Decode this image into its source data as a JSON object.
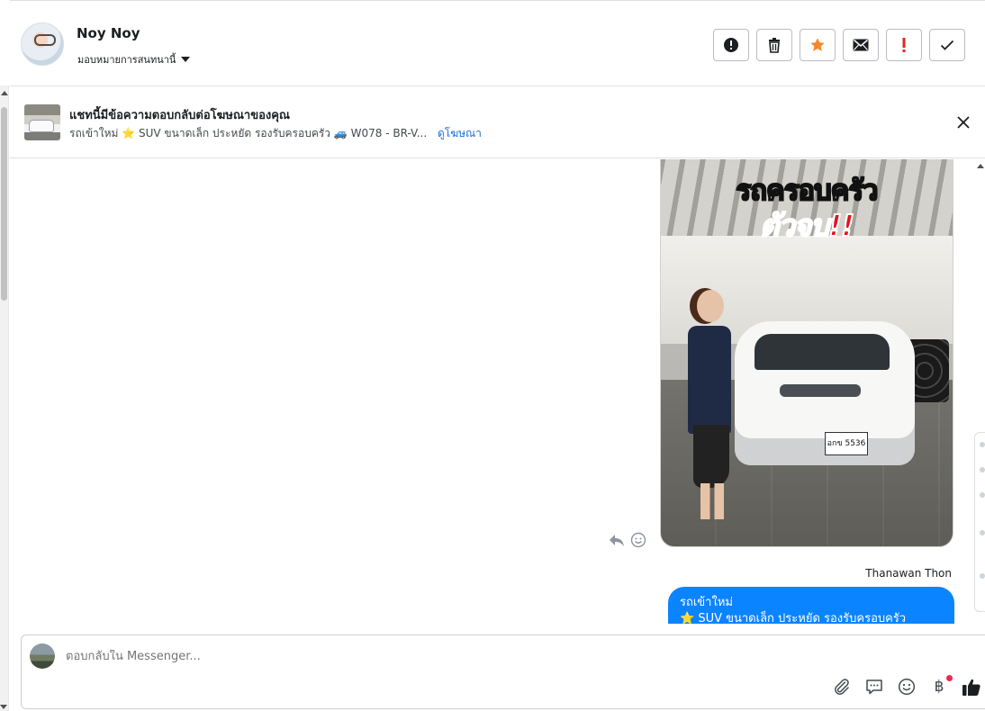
{
  "header": {
    "user_name": "Noy Noy",
    "assign_label": "มอบหมายการสนทนานี้",
    "actions": [
      {
        "name": "report-spam-button",
        "icon": "alert-circle-icon"
      },
      {
        "name": "delete-button",
        "icon": "trash-icon"
      },
      {
        "name": "star-button",
        "icon": "star-icon",
        "color": "#f5862b"
      },
      {
        "name": "mark-unread-button",
        "icon": "envelope-icon"
      },
      {
        "name": "important-button",
        "icon": "exclamation-icon",
        "color": "#e0281a"
      },
      {
        "name": "mark-done-button",
        "icon": "check-icon"
      }
    ]
  },
  "ad_banner": {
    "title": "แชทนี้มีข้อความตอบกลับต่อโฆษณาของคุณ",
    "subtitle": "รถเข้าใหม่ ⭐ SUV ขนาดเล็ก ประหยัด รองรับครอบครัว 🚙 W078 - BR-V...",
    "link_label": "ดูโฆษณา"
  },
  "messages": {
    "image_promo_line1": "รถครอบครัว",
    "image_promo_line2": "ตัวจบ!!",
    "image_plate": "อกข 5536",
    "sender_name": "Thanawan Thon",
    "bubble_line1": "รถเข้าใหม่",
    "bubble_line2": "⭐ SUV ขนาดเล็ก ประหยัด รองรับครอบครัว"
  },
  "composer": {
    "placeholder": "ตอบกลับใน Messenger...",
    "tools": [
      "paperclip-icon",
      "saved-reply-icon",
      "emoji-icon",
      "baht-icon",
      "thumbs-up-icon"
    ],
    "baht_symbol": "฿"
  },
  "colors": {
    "bubble": "#0b84ff",
    "link": "#1a6ed8",
    "star": "#f5862b",
    "important": "#e0281a"
  }
}
